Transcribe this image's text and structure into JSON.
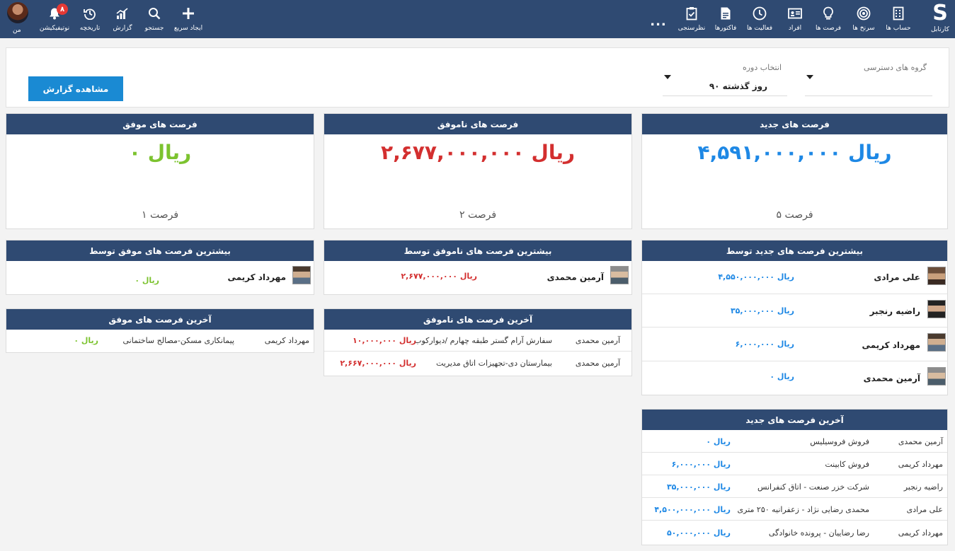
{
  "topbar": {
    "logo_letter": "S",
    "right_items": [
      {
        "label": "کارتابل",
        "icon": "kartabl-icon"
      },
      {
        "label": "حساب ها",
        "icon": "account-icon"
      },
      {
        "label": "سرنخ ها",
        "icon": "target-icon"
      },
      {
        "label": "فرصت ها",
        "icon": "lightbulb-icon"
      },
      {
        "label": "افراد",
        "icon": "id-card-icon"
      },
      {
        "label": "فعالیت ها",
        "icon": "clock-icon"
      },
      {
        "label": "فاکتورها",
        "icon": "document-icon"
      },
      {
        "label": "نظرسنجی",
        "icon": "clipboard-icon"
      }
    ],
    "more": "...",
    "left_items": [
      {
        "label": "ایجاد سریع",
        "icon": "plus-icon"
      },
      {
        "label": "جستجو",
        "icon": "search-icon"
      },
      {
        "label": "گزارش",
        "icon": "chart-icon"
      },
      {
        "label": "تاریخچه",
        "icon": "history-icon"
      },
      {
        "label": "نوتیفیکیشن",
        "icon": "bell-icon"
      }
    ],
    "notification_count": "۸",
    "me_label": "من"
  },
  "filter": {
    "access_group_label": "گروه های دسترسی",
    "access_group_value": "",
    "period_label": "انتخاب دوره",
    "period_value": "۹۰ روز گذشته",
    "view_report_button": "مشاهده گزارش"
  },
  "kpis": {
    "new": {
      "title": "فرصت های جدید",
      "amount": "۴,۵۹۱,۰۰۰,۰۰۰ ریال",
      "count": "۵ فرصت",
      "color": "#1e88e5"
    },
    "lost": {
      "title": "فرصت های ناموفق",
      "amount": "۲,۶۷۷,۰۰۰,۰۰۰ ریال",
      "count": "۲ فرصت",
      "color": "#d32f2f"
    },
    "won": {
      "title": "فرصت های موفق",
      "amount": "۰ ریال",
      "count": "۱ فرصت",
      "color": "#7cc32f"
    }
  },
  "top_new": {
    "title": "بیشترین فرصت های جدید توسط",
    "rows": [
      {
        "name": "علی مرادی",
        "amount": "۴,۵۵۰,۰۰۰,۰۰۰ ریال"
      },
      {
        "name": "راضیه رنجبر",
        "amount": "۳۵,۰۰۰,۰۰۰ ریال"
      },
      {
        "name": "مهرداد کریمی",
        "amount": "۶,۰۰۰,۰۰۰ ریال"
      },
      {
        "name": "آرمین محمدی",
        "amount": "۰ ریال"
      }
    ]
  },
  "top_lost": {
    "title": "بیشترین فرصت های ناموفق توسط",
    "rows": [
      {
        "name": "آرمین محمدی",
        "amount": "۲,۶۷۷,۰۰۰,۰۰۰ ریال"
      }
    ]
  },
  "top_won": {
    "title": "بیشترین فرصت های موفق توسط",
    "rows": [
      {
        "name": "مهرداد کریمی",
        "amount": "۰ ریال"
      }
    ]
  },
  "last_lost": {
    "title": "آخرین فرصت های ناموفق",
    "rows": [
      {
        "person": "آرمین محمدی",
        "subject": "سفارش آرام گستر طبقه چهارم /دیوارکوب",
        "amount": "۱۰,۰۰۰,۰۰۰ ریال"
      },
      {
        "person": "آرمین محمدی",
        "subject": "بیمارستان دی-تجهیزات اتاق مدیریت",
        "amount": "۲,۶۶۷,۰۰۰,۰۰۰ ریال"
      }
    ]
  },
  "last_won": {
    "title": "آخرین فرصت های موفق",
    "rows": [
      {
        "person": "مهرداد کریمی",
        "subject": "پیمانکاری مسکن-مصالح ساختمانی",
        "amount": "۰ ریال"
      }
    ]
  },
  "last_new": {
    "title": "آخرین فرصت های جدید",
    "rows": [
      {
        "person": "آرمین محمدی",
        "subject": "فروش فروسیلیس",
        "amount": "۰ ریال"
      },
      {
        "person": "مهرداد کریمی",
        "subject": "فروش کابینت",
        "amount": "۶,۰۰۰,۰۰۰ ریال"
      },
      {
        "person": "راضیه رنجبر",
        "subject": "شرکت خزر صنعت - اتاق کنفرانس",
        "amount": "۳۵,۰۰۰,۰۰۰ ریال"
      },
      {
        "person": "علی مرادی",
        "subject": "محمدی رضایی نژاد - زعفرانیه ۲۵۰ متری",
        "amount": "۴,۵۰۰,۰۰۰,۰۰۰ ریال"
      },
      {
        "person": "مهرداد کریمی",
        "subject": "رضا رضاییان - پرونده خانوادگی",
        "amount": "۵۰,۰۰۰,۰۰۰ ریال"
      }
    ]
  }
}
